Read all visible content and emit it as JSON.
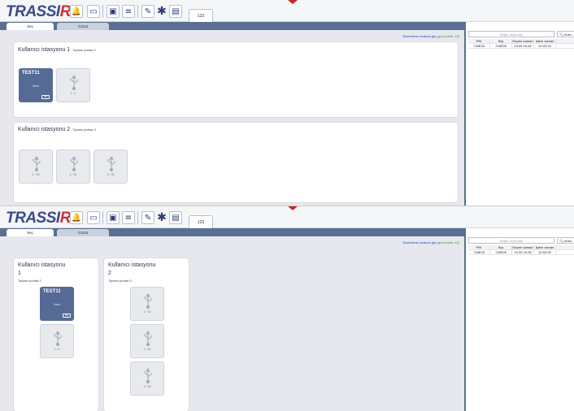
{
  "app": {
    "logo_main": "TRASSI",
    "logo_accent": "R",
    "channel_tab": "123"
  },
  "toolbar_icons": [
    "bell-icon",
    "screens-icon",
    "monitor-icon",
    "layout-icon",
    "wrench-icon",
    "puzzle-icon",
    "chart-icon"
  ],
  "tabs": [
    {
      "label": "Seç",
      "active": true
    },
    {
      "label": "Gözat",
      "active": false
    }
  ],
  "edit_mode": {
    "link": "Düzenleme moduna geç",
    "note": "(gizli portlar: 42)"
  },
  "search": {
    "placeholder": "Değer veya sayı",
    "button1": "Aram",
    "button2": "Aram"
  },
  "table": {
    "headers": [
      "PIN",
      "Kişi",
      "Seçme zamanı",
      "İşlem zaman"
    ],
    "rows1": [
      [
        "718E28",
        "718E28",
        "19.06 16:28",
        "22:03:15"
      ]
    ],
    "rows2": [
      [
        "718E28",
        "718E28",
        "19.06 16:28",
        "22:02:00"
      ]
    ]
  },
  "stations": [
    {
      "title": "Kullanıcı istasyonu 1",
      "title_l1": "Kullanıcı istasyonu",
      "title_l2": "1",
      "ports_label": "Toplam portlar:2",
      "device": {
        "name": "TEST11",
        "status": "Hazır",
        "battery": "80"
      },
      "slots": [
        "1 › 1"
      ]
    },
    {
      "title": "Kullanıcı istasyonu 2",
      "title_l1": "Kullanıcı istasyonu",
      "title_l2": "2",
      "ports_label": "Toplam portlar:3",
      "slots": [
        "1 › 13",
        "1 › 14",
        "1 › 16"
      ]
    }
  ],
  "colors": {
    "brand": "#3a4a8a",
    "accent_red": "#d32f2f",
    "tabbar": "#5a6f92",
    "device_card": "#566a96",
    "link": "#1a3cc8",
    "link_note": "#2e9e3e"
  }
}
